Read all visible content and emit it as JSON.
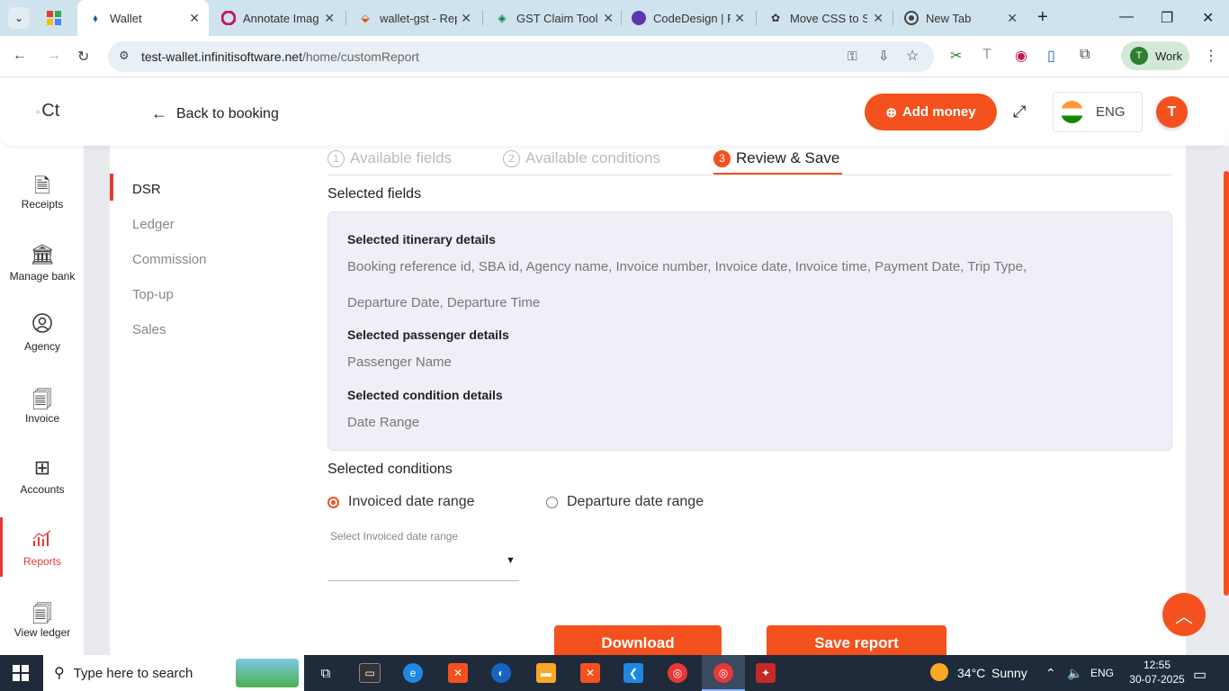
{
  "browser": {
    "tabs": [
      {
        "title": "Wallet",
        "icon": "wallet-icon",
        "active": true
      },
      {
        "title": "Annotate Imag",
        "icon": "annotate-icon"
      },
      {
        "title": "wallet-gst - Rep",
        "icon": "bitbucket-icon"
      },
      {
        "title": "GST Claim Tool",
        "icon": "gst-icon"
      },
      {
        "title": "CodeDesign | F",
        "icon": "codedesign-icon"
      },
      {
        "title": "Move CSS to SC",
        "icon": "chatgpt-icon"
      },
      {
        "title": "New Tab",
        "icon": "chrome-icon"
      }
    ],
    "url_domain": "test-wallet.infinitisoftware.net",
    "url_path": "/home/customReport",
    "profile_label": "Work",
    "profile_initial": "T"
  },
  "header": {
    "logo_alt": "Ct",
    "back_label": "Back to booking",
    "add_money_label": "Add money",
    "language": "ENG",
    "avatar_initial": "T"
  },
  "leftnav": {
    "items": [
      {
        "label": "Receipts",
        "icon": "receipt-icon"
      },
      {
        "label": "Manage bank",
        "icon": "bank-icon"
      },
      {
        "label": "Agency",
        "icon": "user-icon"
      },
      {
        "label": "Invoice",
        "icon": "invoice-icon"
      },
      {
        "label": "Accounts",
        "icon": "calculator-icon"
      },
      {
        "label": "Reports",
        "icon": "bar-chart-icon",
        "active": true
      },
      {
        "label": "View ledger",
        "icon": "ledger-icon"
      }
    ]
  },
  "subnav": {
    "items": [
      "DSR",
      "Ledger",
      "Commission",
      "Top-up",
      "Sales"
    ],
    "active": "DSR"
  },
  "steps": [
    {
      "num": "1",
      "label": "Available fields"
    },
    {
      "num": "2",
      "label": "Available conditions"
    },
    {
      "num": "3",
      "label": "Review & Save",
      "active": true
    }
  ],
  "review": {
    "selected_fields_heading": "Selected fields",
    "itinerary_heading": "Selected itinerary details",
    "itinerary_line1": "Booking reference id,  SBA id,  Agency name,  Invoice number,  Invoice date,  Invoice time,  Payment Date,  Trip Type,",
    "itinerary_line2": "Departure Date,  Departure Time",
    "passenger_heading": "Selected passenger details",
    "passenger_value": "Passenger Name",
    "condition_heading": "Selected condition details",
    "condition_value": "Date Range",
    "conditions_heading": "Selected conditions",
    "radio_invoiced": "Invoiced date range",
    "radio_departure": "Departure date range",
    "select_label": "Select Invoiced date range",
    "download_label": "Download",
    "save_label": "Save report"
  },
  "taskbar": {
    "search_placeholder": "Type here to search",
    "weather_temp": "34°C",
    "weather_text": "Sunny",
    "lang": "ENG",
    "time": "12:55",
    "date": "30-07-2025"
  },
  "colors": {
    "accent": "#f4511e",
    "active_nav": "#e53935"
  }
}
